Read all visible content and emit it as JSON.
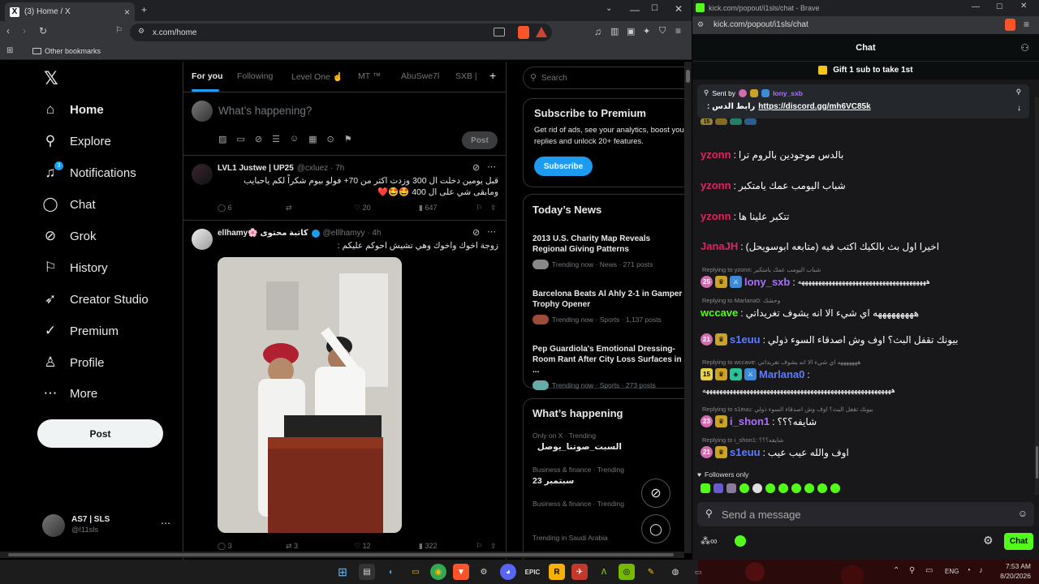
{
  "browser1": {
    "tab_title": "(3) Home / X",
    "url": "x.com/home",
    "bookmark": "Other bookmarks"
  },
  "sidebar": {
    "items": [
      {
        "label": "Home",
        "icon": "home-icon"
      },
      {
        "label": "Explore",
        "icon": "search-icon"
      },
      {
        "label": "Notifications",
        "icon": "bell-icon",
        "badge": "3"
      },
      {
        "label": "Chat",
        "icon": "chat-icon"
      },
      {
        "label": "Grok",
        "icon": "grok-icon"
      },
      {
        "label": "History",
        "icon": "bookmark-icon"
      },
      {
        "label": "Creator Studio",
        "icon": "rocket-icon"
      },
      {
        "label": "Premium",
        "icon": "verified-icon"
      },
      {
        "label": "Profile",
        "icon": "person-icon"
      },
      {
        "label": "More",
        "icon": "more-icon"
      }
    ],
    "post_label": "Post",
    "account_name": "AS7 | SLS",
    "account_handle": "@l11sls"
  },
  "feed": {
    "tabs": [
      "For you",
      "Following",
      "Level One ☝️",
      "MT ™",
      "AbuSwe7l",
      "SXB |"
    ],
    "compose_placeholder": "What’s happening?",
    "compose_post": "Post",
    "tweets": [
      {
        "name": "LVL1 Justwe | UP25",
        "handle": "@cxluez · 7h",
        "text": "قبل يومين دخلت ال 300 وزدت اكثر من 70+ فولو بيوم شكراً لكم ياحبايب ومابقى شي على ال 400 🤩🤩❤️",
        "replies": "6",
        "reposts": "",
        "likes": "20",
        "views": "647"
      },
      {
        "name": "ellhamy🌸 كاتبة محتوى",
        "handle": "@elllhamyy · 4h",
        "text": "زوجة اخوك واخوك وهي تشيش احوكم عليكم :",
        "replies": "3",
        "reposts": "3",
        "likes": "12",
        "views": "322"
      }
    ]
  },
  "right": {
    "search_placeholder": "Search",
    "premium_title": "Subscribe to Premium",
    "premium_text": "Get rid of ads, see your analytics, boost your replies and unlock 20+ features.",
    "subscribe": "Subscribe",
    "news_title": "Today’s News",
    "news": [
      {
        "title": "2013 U.S. Charity Map Reveals Regional Giving Patterns",
        "meta": "Trending now · News · 271 posts"
      },
      {
        "title": "Barcelona Beats Al Ahly 2-1 in Gamper Trophy Opener",
        "meta": "Trending now · Sports · 1,137 posts"
      },
      {
        "title": "Pep Guardiola's Emotional Dressing-Room Rant After City Loss Surfaces in ...",
        "meta": "Trending now · Sports · 273 posts"
      }
    ],
    "happening_title": "What’s happening",
    "trends": [
      {
        "meta": "Only on X · Trending",
        "title": "السبت_صوتنا_يوصل"
      },
      {
        "meta": "Business & finance · Trending",
        "title": "23 سبتمبر"
      },
      {
        "meta": "Business & finance · Trending",
        "title": ""
      },
      {
        "meta": "Trending in Saudi Arabia",
        "title": ""
      }
    ]
  },
  "browser2": {
    "title": "kick.com/popout/i1sls/chat - Brave",
    "url": "kick.com/popout/i1sls/chat"
  },
  "chat": {
    "header": "Chat",
    "gift": "Gift 1 sub to take 1st",
    "pinned_sent_by": "Sent by",
    "pinned_user": "lony_sxb",
    "pinned_text": "رابط الدس :",
    "pinned_link": "https://discord.gg/mh6VC85k",
    "messages": [
      {
        "user": "yzonn",
        "color": "#e0245e",
        "text": "بالدس موجودين بالروم ترا"
      },
      {
        "user": "yzonn",
        "color": "#e0245e",
        "text": "شباب اليومب عمك يامتكبر"
      },
      {
        "user": "yzonn",
        "color": "#e0245e",
        "text": "تتكبر علينا ها"
      },
      {
        "user": "JanaJH",
        "color": "#e0245e",
        "text": "اخيرا اول بث بالكيك اكتب فيه (متابعه ابوسويحل)"
      },
      {
        "reply": "Replying to yzonn: شباب اليومب عمك يامتكبر",
        "user": "lony_sxb",
        "color": "#a970ff",
        "badges": [
          "25",
          "crown",
          "blue"
        ],
        "text": "ههههههههههههههههههههههههههههههههههههههه"
      },
      {
        "reply": "Replying to Marlana0: وحشك",
        "user": "wccave",
        "color": "#53fc18",
        "text": "هههههههههه اي شيء الا انه يشوف تغريداتي"
      },
      {
        "user": "s1euu",
        "color": "#5d7bff",
        "badges": [
          "21",
          "crown"
        ],
        "text": "بيونك تقفل البث؟ اوف وش اصدقاء السوء ذولي"
      },
      {
        "reply": "Replying to wccave: هههههههه اي شيء الا انه يشوف تغريداتي",
        "user": "Marlana0",
        "color": "#5d7bff",
        "badges": [
          "15",
          "crown",
          "teal",
          "blue"
        ],
        "text": "ههههههههههههههههههههههههههههههههههههههههههههههههههههههههه"
      },
      {
        "reply": "Replying to s1euu: بيونك تقفل البث؟ اوف وش اصدقاء السوء ذولي",
        "user": "i_shon1",
        "color": "#a970ff",
        "badges": [
          "23",
          "crown"
        ],
        "text": "شايفه؟؟؟"
      },
      {
        "reply": "Replying to i_shon1: شايفه؟؟؟",
        "user": "s1euu",
        "color": "#5d7bff",
        "badges": [
          "21",
          "crown"
        ],
        "text": "اوف والله عيب عيب"
      }
    ],
    "followers_only": "Followers only",
    "send_placeholder": "Send a message",
    "chat_button": "Chat"
  },
  "taskbar": {
    "lang": "ENG",
    "time": "7:53 AM",
    "date": "8/20/2026"
  },
  "colors": {
    "x_blue": "#1d9bf0",
    "kick_green": "#53fc18"
  }
}
